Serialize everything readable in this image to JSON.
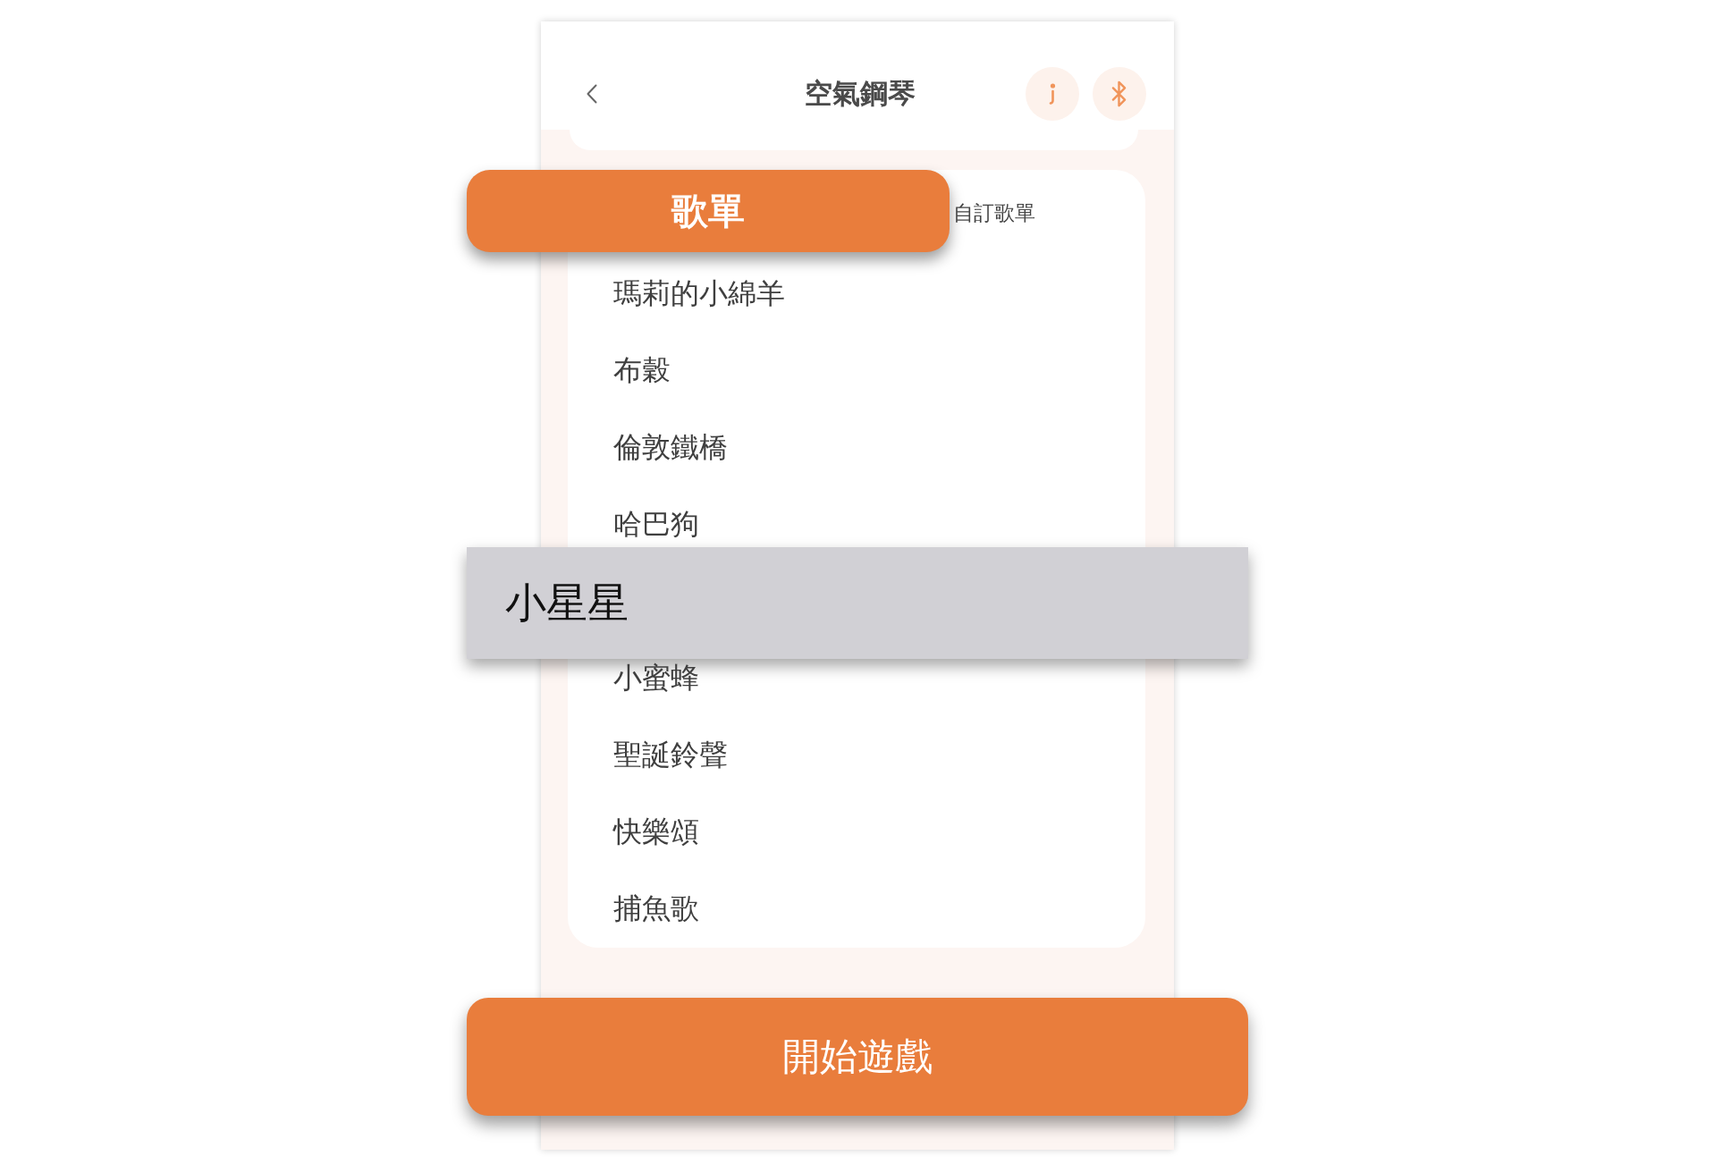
{
  "header": {
    "title": "空氣鋼琴"
  },
  "tabs": [
    {
      "label": "歌單",
      "selected": true
    },
    {
      "label": "自訂歌單",
      "selected": false
    }
  ],
  "songs": [
    {
      "title": "瑪莉的小綿羊",
      "selected": false
    },
    {
      "title": "布穀",
      "selected": false
    },
    {
      "title": "倫敦鐵橋",
      "selected": false
    },
    {
      "title": "哈巴狗",
      "selected": false
    },
    {
      "title": "小星星",
      "selected": true
    },
    {
      "title": "小蜜蜂",
      "selected": false
    },
    {
      "title": "聖誕鈴聲",
      "selected": false
    },
    {
      "title": "快樂頌",
      "selected": false
    },
    {
      "title": "捕魚歌",
      "selected": false
    }
  ],
  "start_button": {
    "label": "開始遊戲"
  }
}
